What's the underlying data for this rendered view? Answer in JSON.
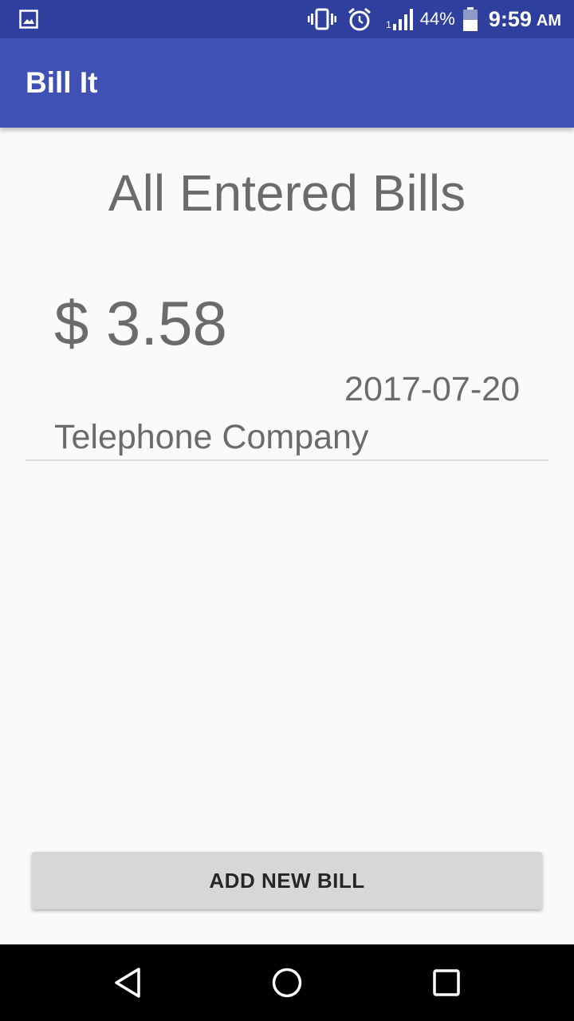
{
  "status_bar": {
    "battery_percent": "44%",
    "time": "9:59",
    "ampm": "AM",
    "signal_label": "1",
    "icons": [
      "image-icon",
      "vibrate-icon",
      "alarm-icon",
      "signal-icon",
      "battery-icon"
    ]
  },
  "app_bar": {
    "title": "Bill It",
    "color": "#3f51b5",
    "status_color": "#2f3f9e"
  },
  "main": {
    "heading": "All Entered Bills",
    "bills": [
      {
        "amount": "$ 3.58",
        "date": "2017-07-20",
        "company": "Telephone Company"
      }
    ],
    "add_button_label": "ADD NEW BILL"
  },
  "nav_bar": {
    "icons": [
      "back-icon",
      "home-icon",
      "recents-icon"
    ]
  }
}
